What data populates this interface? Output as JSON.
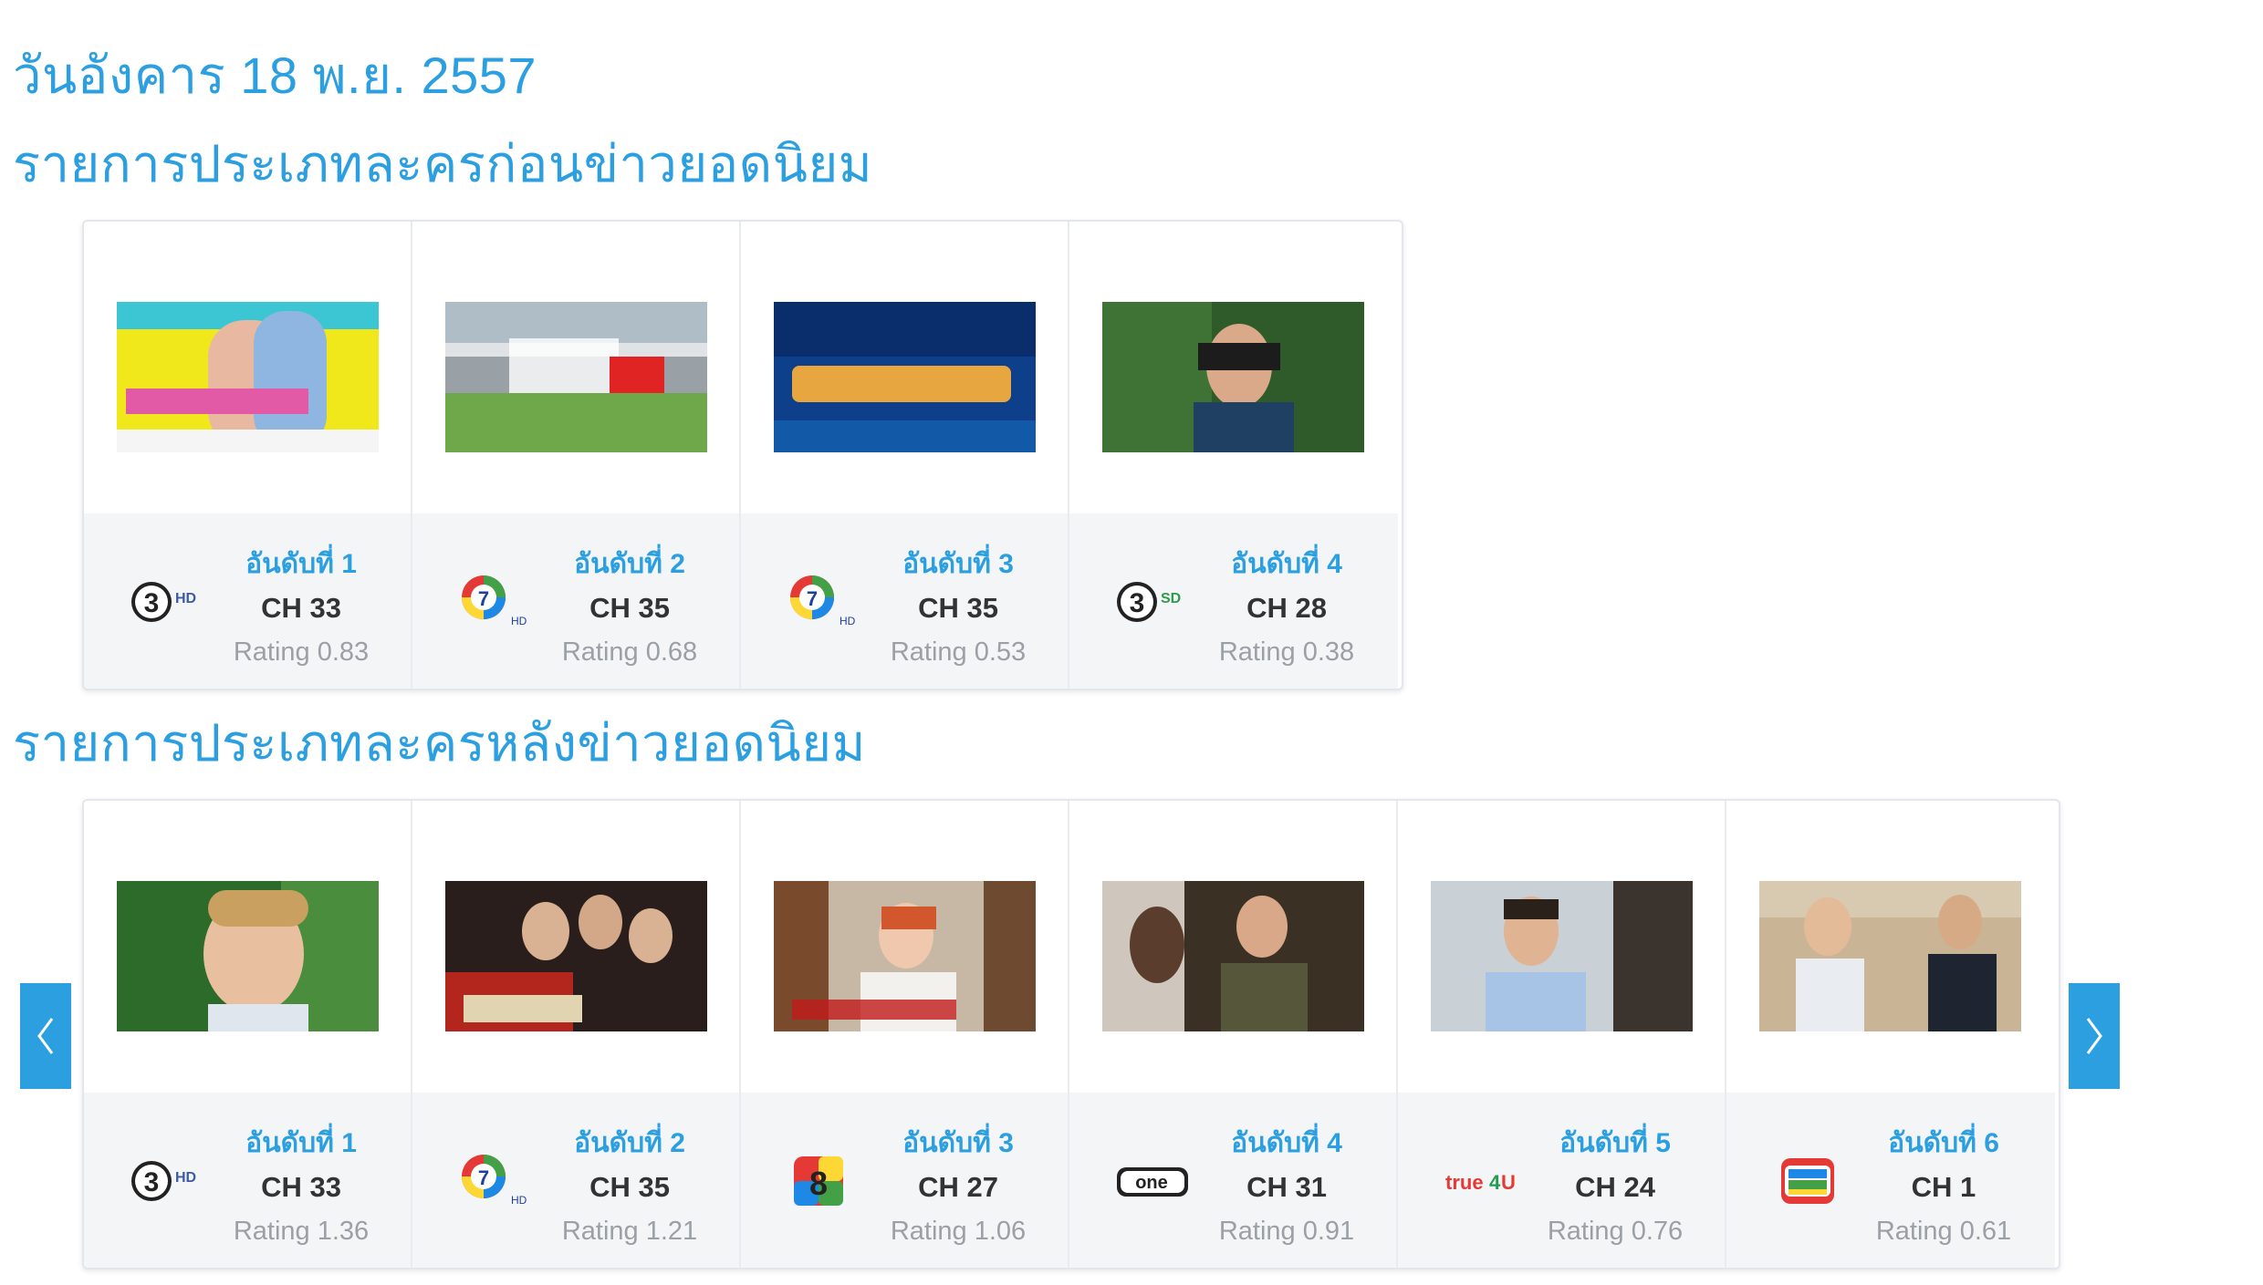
{
  "date_heading": "วันอังคาร 18 พ.ย. 2557",
  "sections": [
    {
      "title": "รายการประเภทละครก่อนข่าวยอดนิยม",
      "items": [
        {
          "rank": "อันดับที่ 1",
          "channel": "CH 33",
          "rating": "Rating 0.83",
          "logo": "ch3-hd-logo-icon"
        },
        {
          "rank": "อันดับที่ 2",
          "channel": "CH 35",
          "rating": "Rating 0.68",
          "logo": "ch7-logo-icon"
        },
        {
          "rank": "อันดับที่ 3",
          "channel": "CH 35",
          "rating": "Rating 0.53",
          "logo": "ch7-logo-icon"
        },
        {
          "rank": "อันดับที่ 4",
          "channel": "CH 28",
          "rating": "Rating 0.38",
          "logo": "ch3-sd-logo-icon"
        }
      ]
    },
    {
      "title": "รายการประเภทละครหลังข่าวยอดนิยม",
      "items": [
        {
          "rank": "อันดับที่ 1",
          "channel": "CH 33",
          "rating": "Rating 1.36",
          "logo": "ch3-hd-logo-icon"
        },
        {
          "rank": "อันดับที่ 2",
          "channel": "CH 35",
          "rating": "Rating 1.21",
          "logo": "ch7-logo-icon"
        },
        {
          "rank": "อันดับที่ 3",
          "channel": "CH 27",
          "rating": "Rating 1.06",
          "logo": "ch8-logo-icon"
        },
        {
          "rank": "อันดับที่ 4",
          "channel": "CH 31",
          "rating": "Rating 0.91",
          "logo": "one-hd-logo-icon"
        },
        {
          "rank": "อันดับที่ 5",
          "channel": "CH 24",
          "rating": "Rating 0.76",
          "logo": "true4u-logo-icon"
        },
        {
          "rank": "อันดับที่ 6",
          "channel": "CH 1",
          "rating": "Rating 0.61",
          "logo": "ch5-logo-icon"
        }
      ]
    }
  ],
  "colors": {
    "accent": "#2b9fe0",
    "rating_text": "#9aa0a6",
    "channel_text": "#333333",
    "card_bottom": "#f4f5f7"
  },
  "nav": {
    "prev_icon": "chevron-left-icon",
    "next_icon": "chevron-right-icon"
  }
}
